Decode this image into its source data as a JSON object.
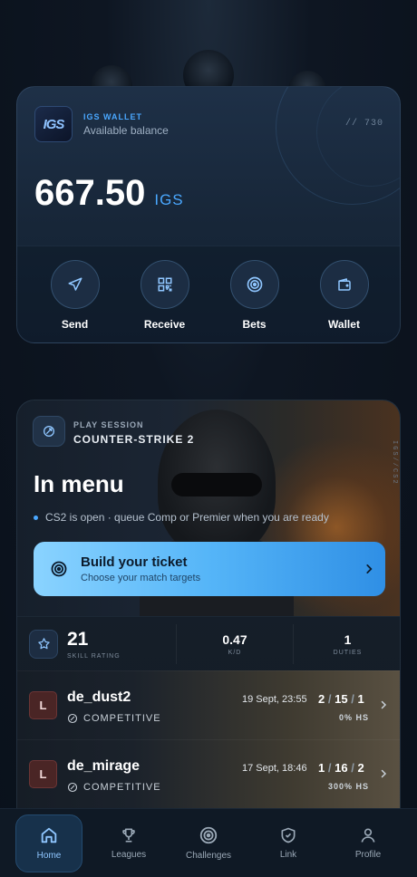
{
  "wallet": {
    "label": "IGS WALLET",
    "sub": "Available balance",
    "code": "// 730",
    "logo_text": "IGS",
    "balance": "667.50",
    "unit": "IGS",
    "actions": [
      {
        "label": "Send",
        "icon": "send-icon"
      },
      {
        "label": "Receive",
        "icon": "qr-code-icon"
      },
      {
        "label": "Bets",
        "icon": "target-icon"
      },
      {
        "label": "Wallet",
        "icon": "wallet-icon"
      }
    ]
  },
  "session": {
    "label": "PLAY SESSION",
    "game": "COUNTER-STRIKE 2",
    "side_text": "IGS//CS2",
    "title": "In menu",
    "status": "CS2 is open · queue Comp or Premier when you are ready",
    "ticket": {
      "title": "Build your ticket",
      "sub": "Choose your match targets"
    },
    "stats": {
      "skill_value": "21",
      "skill_label": "SKILL RATING",
      "kd_value": "0.47",
      "kd_label": "K/D",
      "duties_value": "1",
      "duties_label": "DUTIES"
    },
    "matches": [
      {
        "result": "L",
        "map": "de_dust2",
        "mode": "COMPETITIVE",
        "date": "19 Sept, 23:55",
        "k": "2",
        "d": "15",
        "a": "1",
        "hs": "0% HS"
      },
      {
        "result": "L",
        "map": "de_mirage",
        "mode": "COMPETITIVE",
        "date": "17 Sept, 18:46",
        "k": "1",
        "d": "16",
        "a": "2",
        "hs": "300% HS"
      }
    ]
  },
  "nav": [
    {
      "label": "Home",
      "icon": "home-icon",
      "active": true
    },
    {
      "label": "Leagues",
      "icon": "trophy-icon",
      "active": false
    },
    {
      "label": "Challenges",
      "icon": "target-icon",
      "active": false
    },
    {
      "label": "Link",
      "icon": "shield-icon",
      "active": false
    },
    {
      "label": "Profile",
      "icon": "user-icon",
      "active": false
    }
  ],
  "colors": {
    "accent": "#4aa8ff",
    "loss_badge": "#4a2525",
    "ticket_gradient_start": "#8ad3ff",
    "ticket_gradient_end": "#2f8fe5"
  }
}
